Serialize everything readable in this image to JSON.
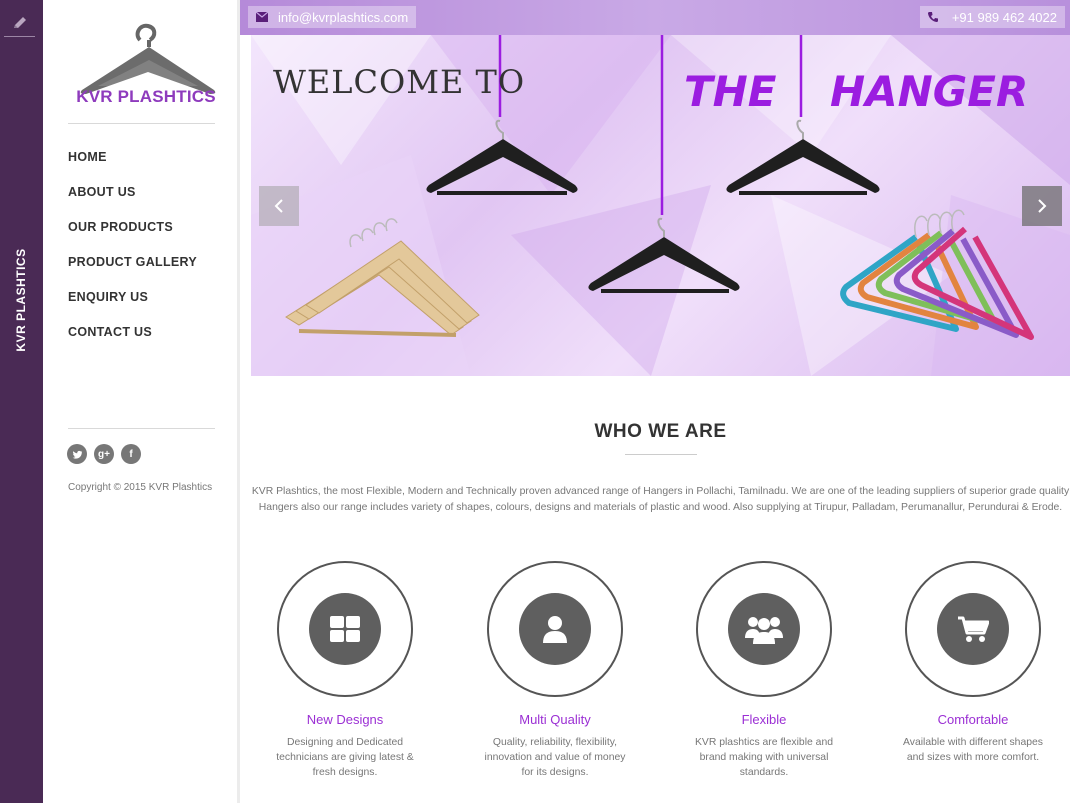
{
  "strip": {
    "brand": "KVR PLASHTICS",
    "edit_icon": "pencil-icon"
  },
  "sidebar": {
    "logo_text": "KVR PLASHTICS",
    "nav": [
      "HOME",
      "ABOUT US",
      "OUR PRODUCTS",
      "PRODUCT GALLERY",
      "ENQUIRY US",
      "CONTACT US"
    ],
    "socials": [
      "twitter-icon",
      "google-plus-icon",
      "facebook-icon"
    ],
    "copyright": "Copyright © 2015 KVR Plashtics"
  },
  "topbar": {
    "email": "info@kvrplashtics.com",
    "phone": "+91 989 462 4022"
  },
  "hero": {
    "welcome": "WELCOME TO",
    "the": "THE",
    "hanger": "HANGER",
    "prev_icon": "chevron-left-icon",
    "next_icon": "chevron-right-icon"
  },
  "who": {
    "title": "WHO WE ARE",
    "text": "KVR Plashtics, the most Flexible, Modern and Technically proven advanced range of Hangers in Pollachi, Tamilnadu. We are one of the leading suppliers of superior grade quality Hangers also our range includes variety of shapes, colours, designs and materials of plastic and wood. Also supplying at Tirupur, Palladam, Perumanallur, Perundurai & Erode."
  },
  "features": [
    {
      "title": "New Designs",
      "text": "Designing and Dedicated technicians are giving latest & fresh designs.",
      "icon": "grid-icon"
    },
    {
      "title": "Multi Quality",
      "text": "Quality, reliability, flexibility, innovation and value of money for its designs.",
      "icon": "user-icon"
    },
    {
      "title": "Flexible",
      "text": "KVR plashtics are flexible and brand making with universal standards.",
      "icon": "users-icon"
    },
    {
      "title": "Comfortable",
      "text": "Available with different shapes and sizes with more comfort.",
      "icon": "shopping-cart-icon"
    }
  ],
  "colors": {
    "accent": "#9b2fd4",
    "strip": "#4a2a55",
    "topbar": "#b58ad9"
  }
}
